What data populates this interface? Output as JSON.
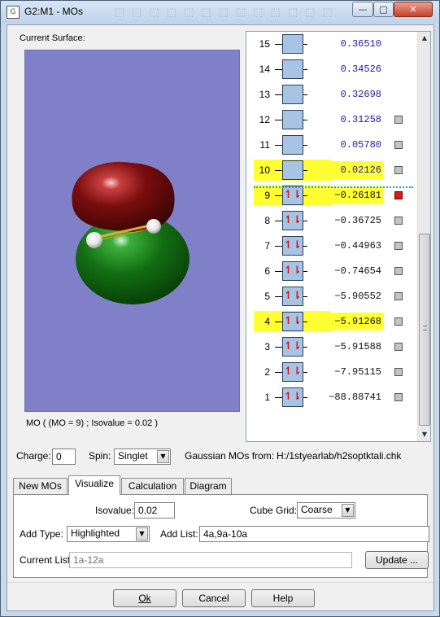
{
  "window": {
    "title": "G2:M1 - MOs",
    "app_icon": "gaussview-icon",
    "buttons": {
      "minimize": "—",
      "maximize": "□",
      "close": "✕"
    }
  },
  "surface": {
    "label": "Current Surface:",
    "caption": "MO ( (MO = 9) ; Isovalue = 0.02 )",
    "colors": {
      "background": "#8080c8",
      "positive_lobe": "#7a0d0d",
      "negative_lobe": "#136e13",
      "atom": "#ffffff",
      "bond": "#d0b030"
    }
  },
  "mo_list": {
    "rows": [
      {
        "num": "15",
        "energy": "0.36510",
        "occupied": false,
        "highlight": false,
        "check": "none"
      },
      {
        "num": "14",
        "energy": "0.34526",
        "occupied": false,
        "highlight": false,
        "check": "none"
      },
      {
        "num": "13",
        "energy": "0.32698",
        "occupied": false,
        "highlight": false,
        "check": "none"
      },
      {
        "num": "12",
        "energy": "0.31258",
        "occupied": false,
        "highlight": false,
        "check": "off"
      },
      {
        "num": "11",
        "energy": "0.05780",
        "occupied": false,
        "highlight": false,
        "check": "off"
      },
      {
        "num": "10",
        "energy": "0.02126",
        "occupied": false,
        "highlight": true,
        "check": "off"
      },
      {
        "num": "9",
        "energy": "-0.26181",
        "occupied": true,
        "highlight": true,
        "check": "on"
      },
      {
        "num": "8",
        "energy": "-0.36725",
        "occupied": true,
        "highlight": false,
        "check": "off"
      },
      {
        "num": "7",
        "energy": "-0.44963",
        "occupied": true,
        "highlight": false,
        "check": "off"
      },
      {
        "num": "6",
        "energy": "-0.74654",
        "occupied": true,
        "highlight": false,
        "check": "off"
      },
      {
        "num": "5",
        "energy": "-5.90552",
        "occupied": true,
        "highlight": false,
        "check": "off"
      },
      {
        "num": "4",
        "energy": "-5.91268",
        "occupied": true,
        "highlight": true,
        "check": "off"
      },
      {
        "num": "3",
        "energy": "-5.91588",
        "occupied": true,
        "highlight": false,
        "check": "off"
      },
      {
        "num": "2",
        "energy": "-7.95115",
        "occupied": true,
        "highlight": false,
        "check": "off"
      },
      {
        "num": "1",
        "energy": "-88.88741",
        "occupied": true,
        "highlight": false,
        "check": "off"
      }
    ],
    "colors": {
      "highlight": "#ffff33",
      "orbital_box": "#a8c4e4",
      "electron_arrows": "#d41010",
      "energy_text": "#1a1aa8",
      "selected_check": "#e01818"
    }
  },
  "charge_row": {
    "charge_label": "Charge:",
    "charge_value": "0",
    "spin_label": "Spin:",
    "spin_value": "Singlet",
    "source_label": "Gaussian MOs from:",
    "source_path": "H:/1styearlab/h2soptktali.chk"
  },
  "tabs": [
    {
      "label": "New MOs",
      "active": false
    },
    {
      "label": "Visualize",
      "active": true
    },
    {
      "label": "Calculation",
      "active": false
    },
    {
      "label": "Diagram",
      "active": false
    }
  ],
  "visualize": {
    "isovalue_label": "Isovalue:",
    "isovalue": "0.02",
    "cube_grid_label": "Cube Grid:",
    "cube_grid": "Coarse",
    "add_type_label": "Add Type:",
    "add_type": "Highlighted",
    "add_list_label": "Add List:",
    "add_list": "4a,9a-10a",
    "current_list_label": "Current List:",
    "current_list": "1a-12a",
    "update_button": "Update ..."
  },
  "footer": {
    "ok": "Ok",
    "cancel": "Cancel",
    "help": "Help"
  }
}
